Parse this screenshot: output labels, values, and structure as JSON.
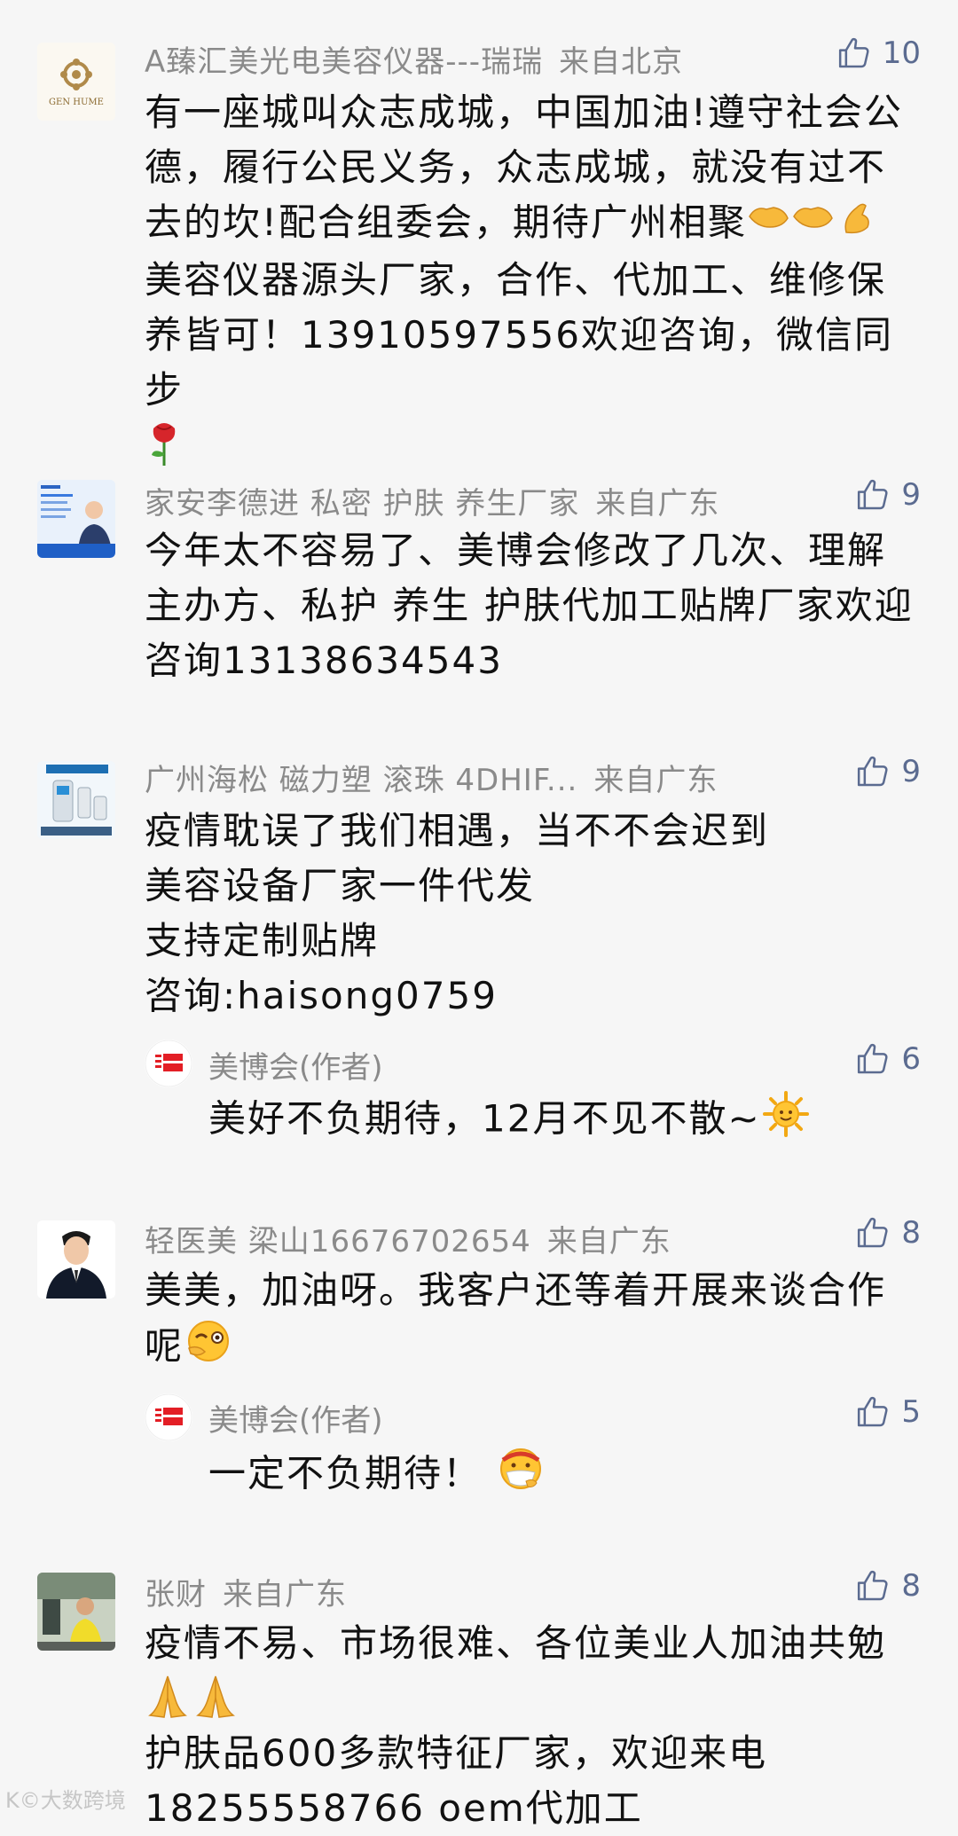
{
  "comments": [
    {
      "name": "A臻汇美光电美容仪器---瑞瑞",
      "location": "来自北京",
      "likes": "10",
      "avatar_text": "GEN HUME",
      "lines": [
        "有一座城叫众志成城，中国加油!遵守社会公",
        "德，履行公民义务，众志成城，就没有过不",
        "去的坎!配合组委会，期待广州相聚",
        "美容仪器源头厂家，合作、代加工、维修保",
        "养皆可！13910597556欢迎咨询，微信同步"
      ]
    },
    {
      "name": "家安李德进 私密 护肤 养生厂家",
      "location": "来自广东",
      "likes": "9",
      "lines": [
        "今年太不容易了、美博会修改了几次、理解",
        "主办方、私护 养生 护肤代加工贴牌厂家欢迎",
        "咨询13138634543"
      ]
    },
    {
      "name": "广州海松 磁力塑 滚珠 4DHIF...",
      "location": "来自广东",
      "likes": "9",
      "lines": [
        "疫情耽误了我们相遇，当不不会迟到",
        "美容设备厂家一件代发",
        "支持定制贴牌",
        "咨询:haisong0759"
      ],
      "reply": {
        "name": "美博会(作者)",
        "likes": "6",
        "text": "美好不负期待，12月不见不散~"
      }
    },
    {
      "name": "轻医美 梁山16676702654",
      "location": "来自广东",
      "likes": "8",
      "lines": [
        "美美，加油呀。我客户还等着开展来谈合作",
        "呢"
      ],
      "reply": {
        "name": "美博会(作者)",
        "likes": "5",
        "text": "一定不负期待！"
      }
    },
    {
      "name": "张财",
      "location": "来自广东",
      "likes": "8",
      "lines": [
        "疫情不易、市场很难、各位美业人加油共勉",
        "",
        "护肤品600多款特征厂家，欢迎来电",
        "18255558766  oem代加工"
      ]
    }
  ],
  "watermark": "K©大数跨境",
  "colors": {
    "name": "#8a8a8a",
    "like": "#5b6b90",
    "text": "#111111",
    "bg": "#f6f6f6"
  }
}
